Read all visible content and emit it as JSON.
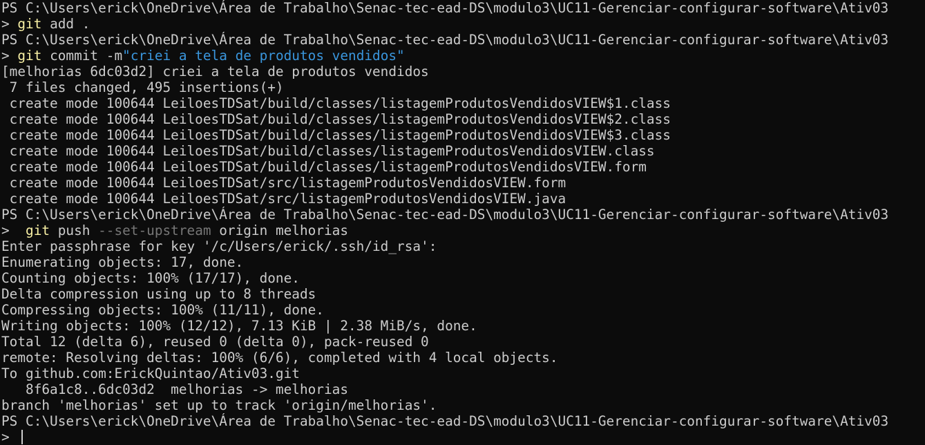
{
  "colors": {
    "background": "#0c0c0c",
    "foreground": "#cccccc",
    "command": "#f9f1a5",
    "parameter": "#767676",
    "string": "#3a96dd"
  },
  "prompt_path": "PS C:\\Users\\erick\\OneDrive\\Área de Trabalho\\Senac-tec-ead-DS\\modulo3\\UC11-Gerenciar-configurar-software\\Ativ03",
  "commands": {
    "add": {
      "prefix": "> ",
      "cmd": "git",
      "rest": " add ."
    },
    "commit": {
      "prefix": "> ",
      "cmd": "git",
      "rest": " commit -m",
      "string": "\"criei a tela de produtos vendidos\""
    },
    "push": {
      "prefix": ">  ",
      "cmd": "git",
      "rest": " push ",
      "flag": "--set-upstream",
      "rest2": " origin melhorias"
    }
  },
  "commit_output": [
    "[melhorias 6dc03d2] criei a tela de produtos vendidos",
    " 7 files changed, 495 insertions(+)",
    " create mode 100644 LeiloesTDSat/build/classes/listagemProdutosVendidosVIEW$1.class",
    " create mode 100644 LeiloesTDSat/build/classes/listagemProdutosVendidosVIEW$2.class",
    " create mode 100644 LeiloesTDSat/build/classes/listagemProdutosVendidosVIEW$3.class",
    " create mode 100644 LeiloesTDSat/build/classes/listagemProdutosVendidosVIEW.class",
    " create mode 100644 LeiloesTDSat/build/classes/listagemProdutosVendidosVIEW.form",
    " create mode 100644 LeiloesTDSat/src/listagemProdutosVendidosVIEW.form",
    " create mode 100644 LeiloesTDSat/src/listagemProdutosVendidosVIEW.java"
  ],
  "push_output": [
    "Enter passphrase for key '/c/Users/erick/.ssh/id_rsa':",
    "Enumerating objects: 17, done.",
    "Counting objects: 100% (17/17), done.",
    "Delta compression using up to 8 threads",
    "Compressing objects: 100% (11/11), done.",
    "Writing objects: 100% (12/12), 7.13 KiB | 2.38 MiB/s, done.",
    "Total 12 (delta 6), reused 0 (delta 0), pack-reused 0",
    "remote: Resolving deltas: 100% (6/6), completed with 4 local objects.",
    "To github.com:ErickQuintao/Ativ03.git",
    "   8f6a1c8..6dc03d2  melhorias -> melhorias",
    "branch 'melhorias' set up to track 'origin/melhorias'."
  ],
  "final_prompt": "> "
}
